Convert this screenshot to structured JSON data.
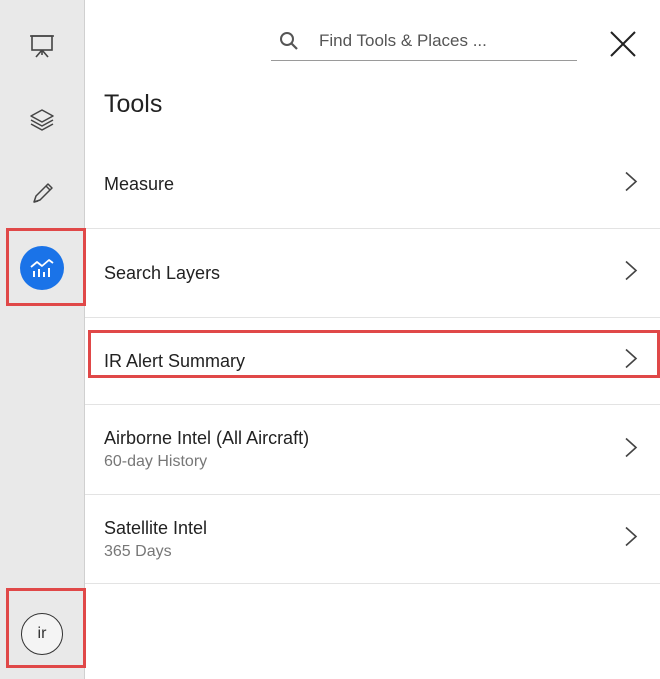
{
  "sidebar": {
    "items": [
      {
        "name": "presentation-icon"
      },
      {
        "name": "layers-icon"
      },
      {
        "name": "pencil-icon"
      },
      {
        "name": "analytics-icon",
        "active": true
      }
    ],
    "avatar_text": "ir"
  },
  "search": {
    "placeholder": "Find Tools & Places ..."
  },
  "panel": {
    "title": "Tools",
    "items": [
      {
        "label": "Measure"
      },
      {
        "label": "Search Layers"
      },
      {
        "label": "IR Alert Summary"
      },
      {
        "label": "Airborne Intel (All Aircraft)",
        "sublabel": "60-day History"
      },
      {
        "label": "Satellite Intel",
        "sublabel": "365 Days"
      }
    ]
  },
  "colors": {
    "accent": "#1a73e8",
    "highlight": "#e04848",
    "sidebar_bg": "#e9e9e9"
  }
}
